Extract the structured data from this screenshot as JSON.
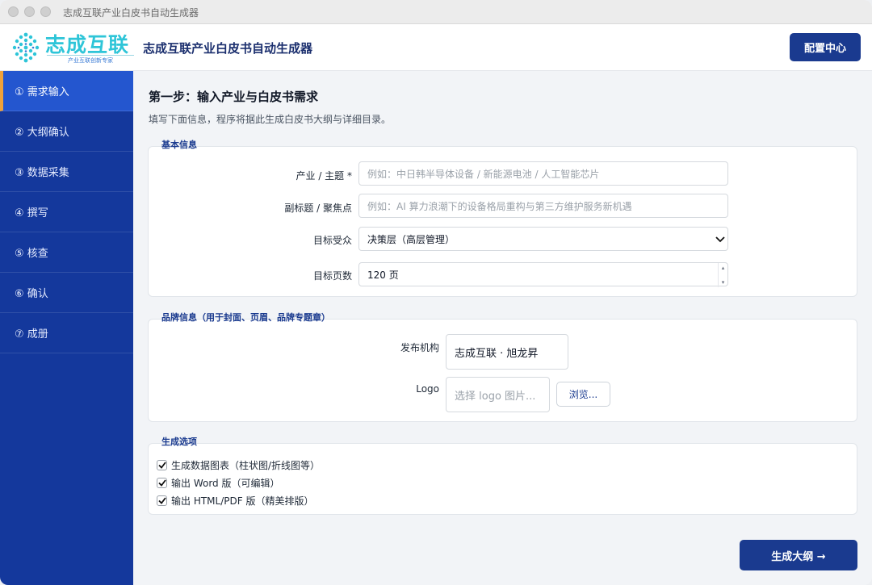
{
  "window": {
    "title": "志成互联产业白皮书自动生成器"
  },
  "header": {
    "logo_text": "志成互联",
    "logo_tagline": "产业互联创新专家",
    "app_title": "志成互联产业白皮书自动生成器",
    "config_button": "配置中心"
  },
  "colors": {
    "primary": "#1a3a8f",
    "sidebar": "#14389c",
    "sidebar_active": "#2456cf",
    "active_indicator": "#f0a23a",
    "logo": "#2ec5d8"
  },
  "sidebar": {
    "items": [
      {
        "label": "① 需求输入",
        "active": true
      },
      {
        "label": "② 大纲确认",
        "active": false
      },
      {
        "label": "③ 数据采集",
        "active": false
      },
      {
        "label": "④ 撰写",
        "active": false
      },
      {
        "label": "⑤ 核查",
        "active": false
      },
      {
        "label": "⑥ 确认",
        "active": false
      },
      {
        "label": "⑦ 成册",
        "active": false
      }
    ]
  },
  "main": {
    "step_title": "第一步：输入产业与白皮书需求",
    "step_desc": "填写下面信息，程序将据此生成白皮书大纲与详细目录。",
    "basic": {
      "section_label": "基本信息",
      "industry_label": "产业 / 主题 *",
      "industry_placeholder": "例如：中日韩半导体设备 / 新能源电池 / 人工智能芯片",
      "subtitle_label": "副标题 / 聚焦点",
      "subtitle_placeholder": "例如：AI 算力浪潮下的设备格局重构与第三方维护服务新机遇",
      "audience_label": "目标受众",
      "audience_value": "决策层（高层管理）",
      "pages_label": "目标页数",
      "pages_value": "120 页"
    },
    "brand": {
      "section_label": "品牌信息（用于封面、页眉、品牌专题章）",
      "publisher_label": "发布机构",
      "publisher_value": "志成互联 · 旭龙昇",
      "logo_label": "Logo",
      "logo_placeholder": "选择 logo 图片...",
      "browse_button": "浏览..."
    },
    "options": {
      "section_label": "生成选项",
      "items": [
        {
          "label": "生成数据图表（柱状图/折线图等）",
          "checked": true
        },
        {
          "label": "输出 Word 版（可编辑）",
          "checked": true
        },
        {
          "label": "输出 HTML/PDF 版（精美排版）",
          "checked": true
        }
      ]
    },
    "generate_button": "生成大纲 →"
  }
}
